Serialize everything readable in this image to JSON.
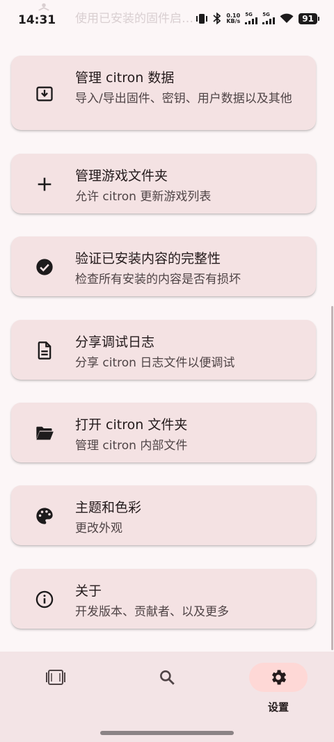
{
  "status_bar": {
    "time": "14:31",
    "net_speed_value": "0.10",
    "net_speed_unit": "KB/s",
    "sim1_label": "5G",
    "sim2_label": "5G",
    "battery": "91",
    "ghost_text": "使用已安装的固件启…"
  },
  "settings": {
    "items": [
      {
        "title": "管理 citron 数据",
        "description": "导入/导出固件、密钥、用户数据以及其他",
        "icon": "download-box-icon"
      },
      {
        "title": "管理游戏文件夹",
        "description": "允许 citron 更新游戏列表",
        "icon": "plus-icon"
      },
      {
        "title": "验证已安装内容的完整性",
        "description": "检查所有安装的内容是否有损坏",
        "icon": "check-circle-icon"
      },
      {
        "title": "分享调试日志",
        "description": "分享 citron 日志文件以便调试",
        "icon": "document-icon"
      },
      {
        "title": "打开 citron 文件夹",
        "description": "管理 citron 内部文件",
        "icon": "folder-open-icon"
      },
      {
        "title": "主题和色彩",
        "description": "更改外观",
        "icon": "palette-icon"
      },
      {
        "title": "关于",
        "description": "开发版本、贡献者、以及更多",
        "icon": "info-icon"
      }
    ]
  },
  "bottom_nav": {
    "games_icon": "games-icon",
    "search_icon": "search-icon",
    "settings_label": "设置",
    "active_color": "#fed8d6"
  }
}
